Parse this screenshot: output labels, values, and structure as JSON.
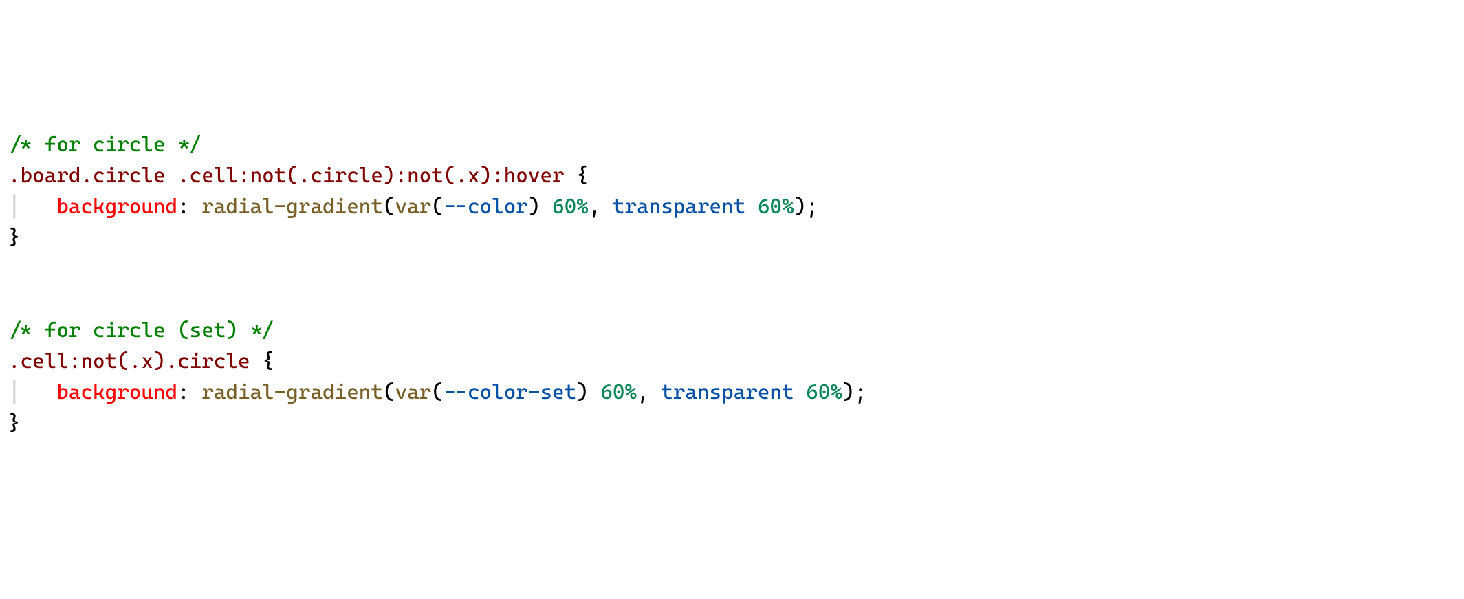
{
  "code": {
    "lines": [
      {
        "indent": false,
        "tokens": [
          {
            "cls": "c-comment",
            "text": "/* for circle */"
          }
        ]
      },
      {
        "indent": false,
        "tokens": [
          {
            "cls": "c-selector",
            "text": ".board.circle"
          },
          {
            "cls": "c-punct",
            "text": " "
          },
          {
            "cls": "c-selector",
            "text": ".cell:not(.circle):not(.x):hover"
          },
          {
            "cls": "c-punct",
            "text": " {"
          }
        ]
      },
      {
        "indent": true,
        "tokens": [
          {
            "cls": "c-prop",
            "text": "background"
          },
          {
            "cls": "c-punct",
            "text": ": "
          },
          {
            "cls": "c-ident",
            "text": "radial-gradient"
          },
          {
            "cls": "c-punct",
            "text": "("
          },
          {
            "cls": "c-ident",
            "text": "var"
          },
          {
            "cls": "c-punct",
            "text": "("
          },
          {
            "cls": "c-value",
            "text": "--color"
          },
          {
            "cls": "c-punct",
            "text": ") "
          },
          {
            "cls": "c-number",
            "text": "60%"
          },
          {
            "cls": "c-punct",
            "text": ", "
          },
          {
            "cls": "c-value",
            "text": "transparent"
          },
          {
            "cls": "c-punct",
            "text": " "
          },
          {
            "cls": "c-number",
            "text": "60%"
          },
          {
            "cls": "c-punct",
            "text": ");"
          }
        ]
      },
      {
        "indent": false,
        "tokens": [
          {
            "cls": "c-punct",
            "text": "}"
          }
        ]
      },
      {
        "indent": false,
        "tokens": []
      },
      {
        "indent": false,
        "tokens": []
      },
      {
        "indent": false,
        "tokens": [
          {
            "cls": "c-comment",
            "text": "/* for circle (set) */"
          }
        ]
      },
      {
        "indent": false,
        "tokens": [
          {
            "cls": "c-selector",
            "text": ".cell:not(.x).circle"
          },
          {
            "cls": "c-punct",
            "text": " {"
          }
        ]
      },
      {
        "indent": true,
        "tokens": [
          {
            "cls": "c-prop",
            "text": "background"
          },
          {
            "cls": "c-punct",
            "text": ": "
          },
          {
            "cls": "c-ident",
            "text": "radial-gradient"
          },
          {
            "cls": "c-punct",
            "text": "("
          },
          {
            "cls": "c-ident",
            "text": "var"
          },
          {
            "cls": "c-punct",
            "text": "("
          },
          {
            "cls": "c-value",
            "text": "--color-set"
          },
          {
            "cls": "c-punct",
            "text": ") "
          },
          {
            "cls": "c-number",
            "text": "60%"
          },
          {
            "cls": "c-punct",
            "text": ", "
          },
          {
            "cls": "c-value",
            "text": "transparent"
          },
          {
            "cls": "c-punct",
            "text": " "
          },
          {
            "cls": "c-number",
            "text": "60%"
          },
          {
            "cls": "c-punct",
            "text": ");"
          }
        ]
      },
      {
        "indent": false,
        "tokens": [
          {
            "cls": "c-punct",
            "text": "}"
          }
        ]
      }
    ]
  }
}
